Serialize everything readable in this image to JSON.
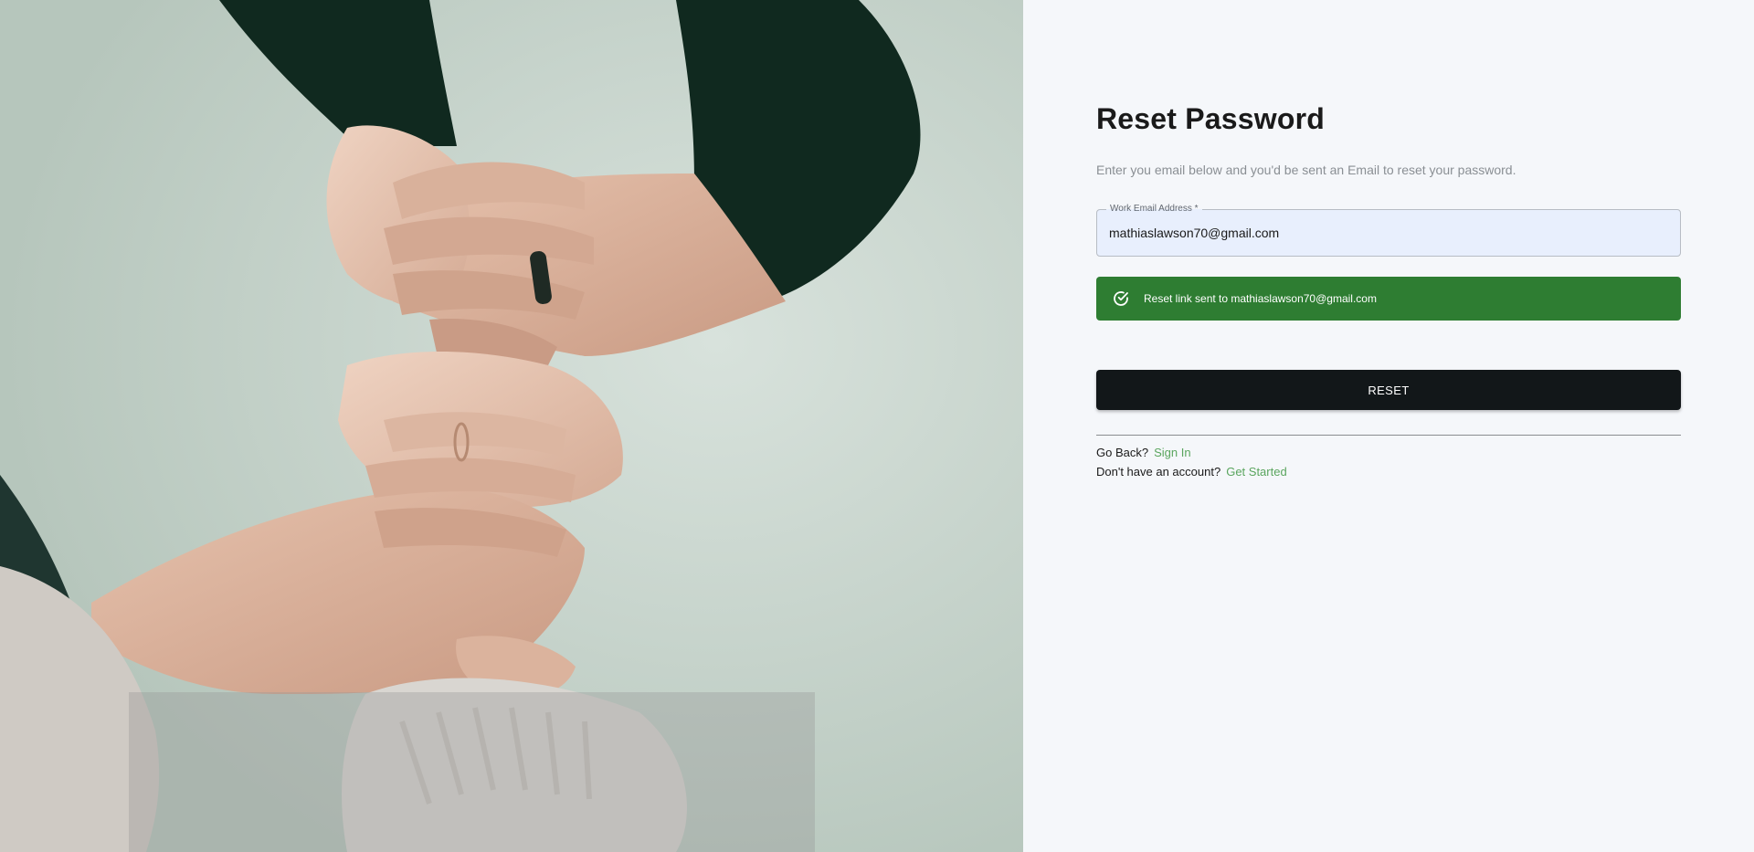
{
  "hero": {
    "image_description": "photo-hands-holding"
  },
  "form": {
    "title": "Reset Password",
    "subtitle": "Enter you email below and you'd be sent an Email to reset your password.",
    "email_label": "Work Email Address *",
    "email_value": "mathiaslawson70@gmail.com",
    "email_placeholder": "",
    "alert_message": "Reset link sent to mathiaslawson70@gmail.com",
    "alert_icon": "check-circle-icon",
    "reset_label": "RESET"
  },
  "links": {
    "go_back_prompt": "Go Back?",
    "sign_in_label": "Sign In",
    "no_account_prompt": "Don't have an account?",
    "get_started_label": "Get Started"
  },
  "colors": {
    "success": "#2e7d32",
    "button": "#121719",
    "link": "#5aa55e",
    "input_bg": "#e8effd"
  }
}
